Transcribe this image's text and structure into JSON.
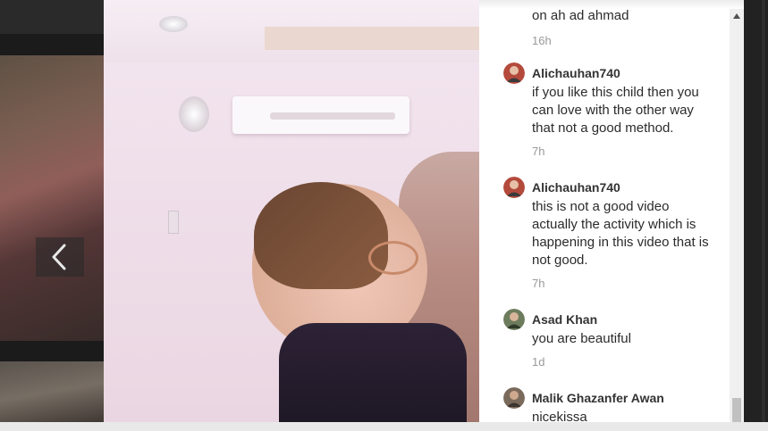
{
  "navigation": {
    "prev_icon": "chevron-left-icon"
  },
  "comments": [
    {
      "text": "on ah ad ahmad",
      "time": "16h"
    },
    {
      "author": "Alichauhan740",
      "text": "if you like this child then you can love with the other way that not a good method.",
      "time": "7h"
    },
    {
      "author": "Alichauhan740",
      "text": "this is not a good video actually the activity which is happening in this video that is not good.",
      "time": "7h"
    },
    {
      "author": "Asad Khan",
      "text": "you are beautiful",
      "time": "1d"
    },
    {
      "author": "Malik Ghazanfer Awan",
      "text": "nicekissa",
      "time": ""
    }
  ],
  "scrollbar": {
    "up_icon": "triangle-up-icon",
    "position": 0.97
  },
  "colors": {
    "panel_bg": "#ffffff",
    "name_text": "#333333",
    "time_text": "#999999",
    "page_bg": "#1a1a1a"
  }
}
